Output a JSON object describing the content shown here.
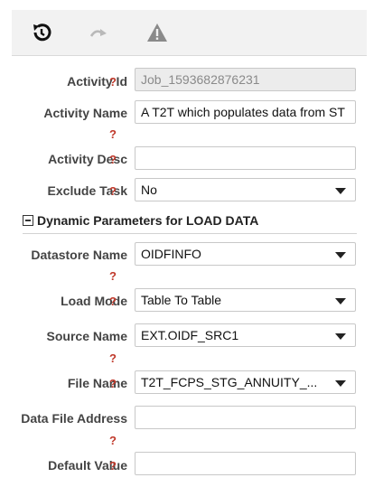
{
  "toolbar": {
    "icons": [
      "history-icon",
      "redo-icon",
      "warning-icon"
    ]
  },
  "help_glyph": "?",
  "fields": {
    "activity_id": {
      "label": "Activity Id",
      "value": "Job_1593682876231"
    },
    "activity_name": {
      "label": "Activity Name",
      "value": "A T2T which populates data from  ST"
    },
    "activity_desc": {
      "label": "Activity Desc",
      "value": ""
    },
    "exclude_task": {
      "label": "Exclude Task",
      "value": "No"
    }
  },
  "section": {
    "title": "Dynamic Parameters for LOAD DATA"
  },
  "params": {
    "datastore_name": {
      "label": "Datastore Name",
      "value": "OIDFINFO"
    },
    "load_mode": {
      "label": "Load Mode",
      "value": "Table To Table"
    },
    "source_name": {
      "label": "Source Name",
      "value": "EXT.OIDF_SRC1"
    },
    "file_name": {
      "label": "File Name",
      "value": "T2T_FCPS_STG_ANNUITY_..."
    },
    "data_file_address": {
      "label": "Data File Address",
      "value": ""
    },
    "default_value": {
      "label": "Default Value",
      "value": ""
    }
  }
}
